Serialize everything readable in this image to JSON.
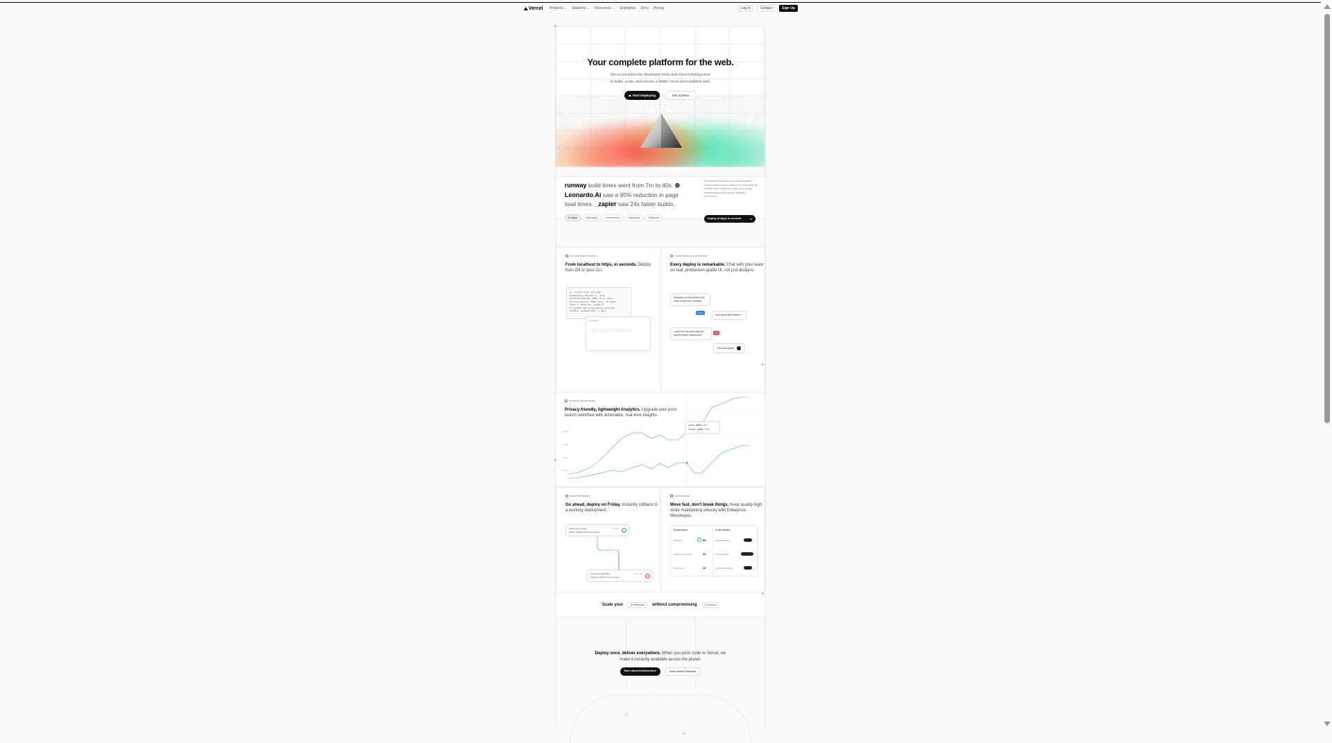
{
  "nav": {
    "brand": "Vercel",
    "links": [
      "Products",
      "Solutions",
      "Resources",
      "Enterprise",
      "Docs",
      "Pricing"
    ],
    "login": "Log In",
    "contact": "Contact",
    "signup": "Sign Up"
  },
  "hero": {
    "title": "Your complete platform for the web.",
    "subtitle_1": "Vercel provides the developer tools and cloud infrastructure",
    "subtitle_2": "to build, scale, and secure a faster, more personalized web.",
    "cta_primary": "Start Deploying",
    "cta_secondary": "Get a Demo"
  },
  "stats": {
    "brand_1": "runway",
    "text_1": " build times went from 7m to 40s.",
    "brand_2": "Leonardo.Ai",
    "text_2": " saw a 95% reduction in page load times. ",
    "brand_3": "_zapier",
    "text_3": " saw 24x faster builds.",
    "side_text": "Get started using our pre-built templates. Easily stream long-running LLM responses for a better user experience with zero-config infrastructure that's always globally performant.",
    "tabs": [
      "AI Apps",
      "Web Apps",
      "Ecommerce",
      "Marketing",
      "Platforms"
    ],
    "cta": "Deploy AI Apps in seconds"
  },
  "git_card": {
    "kicker": "Git-connected Deploys",
    "title_bold": "From localhost to https, in seconds.",
    "title_rest": " Deploy from Git or your CLI.",
    "code_lines": [
      "▲ ~ vercel-site/ git push",
      "Enumerating objects: 1, done.",
      "Counting objects: 100% (1/1), done.",
      "Writing objects: 100% (1/1), 72 bytes",
      "Total 1 (delta 0), reused 0",
      "To github.com:vercel/vercel-site.git",
      "  21326ca..4ca4ae2 main -> main"
    ],
    "deploy_label": "vercel.app",
    "watermark": "Vercel Preview"
  },
  "collab_card": {
    "kicker": "Collaborative pre-production",
    "title_bold": "Every deploy is remarkable.",
    "title_rest": " Chat with your team on real, production-grade UI, not just designs.",
    "msg_1": "Separate out the sections for extra context (as needed)",
    "msg_2": "How about this instead?",
    "msg_3": "I can't find the point with the brand header dimensions?",
    "msg_4": "This looks great",
    "chip_1": "Design",
    "chip_2": "Eng"
  },
  "analytics": {
    "kicker": "Frontend Observability",
    "title_bold": "Privacy-friendly, lightweight Analytics.",
    "title_rest": " Upgrade your post-launch workflow with actionable, real-time insights.",
    "y_ticks": [
      "3,600",
      "2,400",
      "1,200",
      "1,000"
    ],
    "tip_label_1": "Views",
    "tip_value_1": "4631",
    "tip_delta_1": "+4%",
    "tip_label_2": "Visitors",
    "tip_value_2": "2226",
    "tip_delta_2": "+18%"
  },
  "rollback_card": {
    "kicker": "Instant Rollbacks",
    "title_bold": "Go ahead, deploy on Friday.",
    "title_rest": " Instantly rollback to a working deployment.",
    "box_1_line_1": "vercel-site  pdt-fyow",
    "box_1_line_2": "feat/ui: Update home hero design",
    "box_1_meta": "1d ago",
    "box_2_line_1": "vercel-site  pdg-7f8oe",
    "box_2_line_2": "fix(ui): Fix CLS in hero on query",
    "box_2_meta": "10m ago"
  },
  "perf_card": {
    "kicker": "Conformance",
    "title_bold": "Move fast, don't break things.",
    "title_rest": " Keep quality high while maintaining velocity with Enterprise Monorepos.",
    "head_1": "Performance",
    "head_2": "Code Owners",
    "rows": [
      {
        "label": "Excellent",
        "value": "84",
        "owner": "@vercel/design"
      },
      {
        "label": "Needs Improvement",
        "value": "24",
        "owner": "@vercel/billing"
      },
      {
        "label": "Poor Score",
        "value": "12",
        "owner": "@vercel/marketing"
      }
    ]
  },
  "scale": {
    "text_1": "Scale your",
    "badge_1": "Enterprise",
    "text_2": "without compromising",
    "badge_2": "Security"
  },
  "global": {
    "title_bold": "Deploy once, deliver everywhere.",
    "title_rest": " When you push code to Vercel, we make it instantly available across the planet.",
    "cta_primary": "More about Infrastructure",
    "cta_secondary": "Learn about Enterprise"
  }
}
